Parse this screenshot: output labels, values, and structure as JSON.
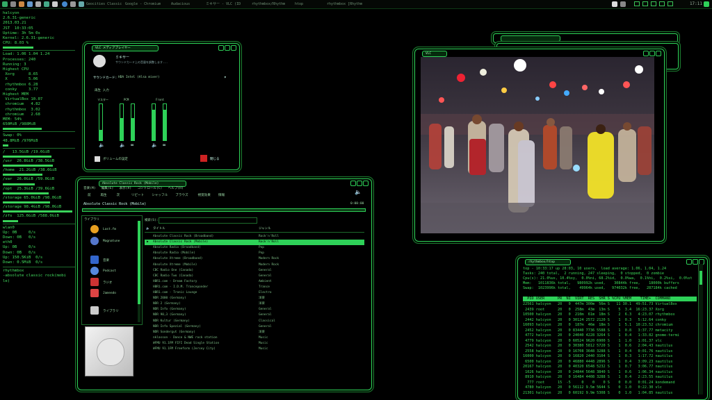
{
  "taskbar": {
    "tasks": [
      "Geocities Classic R",
      "Google - Chromium",
      "Audacious",
      "ミキサー - VLC (ID",
      "rhythmbox/Rhythm",
      "htop",
      "rhythmbox [Rhythm"
    ],
    "clock": "17:11"
  },
  "conky": {
    "lines": [
      "halcyon",
      "2.6.31-generic",
      "2013.03.21",
      "JST  10:33:05",
      "Uptime: 3h 5m 0s",
      "Kernel: 2.6.31-generic",
      "CPU: 8.03 %"
    ],
    "lines2": [
      "Load: 1.06 1.04 1.24",
      "Processes: 240",
      "Running: 3",
      "Highest CPU",
      " Xorg      8.65",
      " X         5.06",
      " rhythmbox 6.28",
      " conky     3.77",
      "Highest MEM",
      " VirtualBox 10.07",
      " chromium   4.82",
      " rhythmbox  3.02",
      " chromium   2.68",
      "MEM: 54%",
      "650MiB /988MiB"
    ],
    "lines3": [
      "Swap: 0%",
      "48.8MiB /976MiB"
    ],
    "disks": [
      "/   13.5GiB /19.6GiB",
      "/usr  26.8GiB /38.5GiB",
      "/home  21.2GiB /38.6GiB",
      "/var  26.0GiB /59.0GiB",
      "/opt  25.3GiB /39.6GiB",
      "/storage 65.0GiB /98.0GiB",
      "/storage 98.4GiB /98.0GiB",
      "/zfs  125.6GiB /588.0GiB"
    ],
    "net": [
      "wlan0",
      "Up: 0B     0/s",
      "Down: 0B   0/s",
      "eth0",
      "Up: 0B     0/s",
      "Down: 0B   0/s",
      "Up: 150.5KiB  0/s",
      "Down: 0.5MiB  0/s"
    ],
    "footer": [
      "rhythmbox",
      "-absolute classic rock(mobi",
      "le)"
    ]
  },
  "mixer": {
    "title": "VLC メディアプレイヤー",
    "heading": "ミキサー",
    "desc": "サウンドカード上の音量を調整します...",
    "card_label": "サウンドカード:",
    "card_value": "HDA Intel (Alsa mixer)",
    "tab": "再生  入力",
    "channels": [
      "マスター",
      "PCM",
      "Front"
    ],
    "levels": [
      0.28,
      0.62,
      0.85
    ],
    "footer_left": "ボリュームの設定",
    "close_label": "閉じる"
  },
  "rhythmbox": {
    "title": "Absolute Classic Rock (Mobile)",
    "menu": [
      "音楽(M)",
      "編集(E)",
      "表示(V)",
      "コントロール(C)",
      "ヘルプ(H)"
    ],
    "toolbar": [
      "前",
      "再生",
      "次",
      "リピート",
      "シャッフル",
      "ブラウズ",
      "視覚効果",
      "情報"
    ],
    "now_playing": "Absolute Classic Rock (Mobile)",
    "time": "0:00:00",
    "side_header": "ライブラリ",
    "side_items": [
      "Last.fm",
      "Magnatune",
      "音楽",
      "Podcast",
      "ラジオ",
      "Jamendo",
      "ライブラリ"
    ],
    "search_label": "検索(S):",
    "col_title": "タイトル",
    "col_genre": "ジャンル",
    "stations": [
      [
        "Absolute Classic Rock (Broadband)",
        "Rock'n'Roll"
      ],
      [
        "Absolute Classic Rock (Mobile)",
        "Rock'n'Roll"
      ],
      [
        "Absolute Radio (Broadband)",
        "Pop"
      ],
      [
        "Absolute Radio (Mobile)",
        "Pop"
      ],
      [
        "Absolute Xtreme (Broadband)",
        "Modern Rock"
      ],
      [
        "Absolute Xtreme (Mobile)",
        "Modern Rock"
      ],
      [
        "CBC Radio One (Canada)",
        "General"
      ],
      [
        "CBC Radio Two (Canada)",
        "General"
      ],
      [
        "HBR1.com - Dream Factory",
        "Ambient"
      ],
      [
        "HBR1.com - I.D.M. Tranceponder",
        "Trance"
      ],
      [
        "HBR1.com - Tronic Lounge",
        "Electro"
      ],
      [
        "NDR 2000 (Germany)",
        "洋楽"
      ],
      [
        "NDR 2 (Germany)",
        "洋楽"
      ],
      [
        "NDR Info (Germany)",
        "General"
      ],
      [
        "NDR 90,3 (Germany)",
        "General"
      ],
      [
        "NDR Kultur (Germany)",
        "Classical"
      ],
      [
        "NDR Info Spezial (Germany)",
        "General"
      ],
      [
        "NDR Sondergut (Germany)",
        "洋楽"
      ],
      [
        "nklasson - Dance & NWE rock station",
        "Music"
      ],
      [
        "WFMU 91.1FM FIFI Dead Single Station",
        "Music"
      ],
      [
        "WFMU 91.1FM Freeform (Jersey City)",
        "Music"
      ]
    ]
  },
  "video": {
    "title": "VLC"
  },
  "htop": {
    "title": "rhythmbox/htop",
    "summary": [
      "top - 10:33:17 up 28:03, 10 users,  load average: 1.06, 1.04, 1.24",
      "Tasks: 240 total,  2 running, 247 sleeping,  0 stopped,  0 zombie",
      "Cpu(s): 21.0%us, 10.4%sy,  0.0%ni, 68.2%id,  0.0%wa,  0.1%hi,  0.2%si,  0.0%st",
      "Mem:   1011836k total,   980992k used,    30844k free,    18000k buffers",
      "Swap:  1023996k total,    49964k used,   974032k free,   287184k cached"
    ],
    "header": "  PID USER      PR  NI  VIRT  RES  SHR S %CPU %MEM    TIME+  COMMAND",
    "rows": [
      "22561 halcyon   20   0  447m 300m  56m S   11 30.1  49:51.73 VirtualBox",
      " 2439 root      20   0  258m  43m  13m S    5  3.4  16:23.37 Xorg",
      "10500 halcyon   20   0  210m  61m  18m S    2  6.3   4:23.07 rhythmbox",
      " 2442 halcyon   20   0 30124 2572 2120 S    1  0.3   5:12.64 conky",
      "16093 halcyon   20   0  187m  46m  18m S    1  5.1  10:23.52 chromium",
      " 2452 halcyon   20   0 83440 7736 5588 S    1  0.8   3:37.77 metacity",
      " 4772 halcyon   20   0 24040 4228 3264 S    1  0.4   1:33.82 gnome-termi",
      " 4779 halcyon   20   0 60524 9620 6900 S    1  1.0   1:01.37 vlc",
      " 2542 halcyon   20   0 30380 5812 5720 S    1  0.6   2:04.43 nautilus",
      " 2558 halcyon   20   0 16708 3648 3288 S    1  0.4   0:01.76 nautilus",
      "16000 halcyon   20   0 16820 2440 3104 S    1  0.3   1:17.72 nautilus",
      " 6500 halcyon   20   0 46880 4448 2896 S    1  0.4   3:09.23 nautilus",
      "20167 halcyon   20   0 40320 6548 5232 S    1  0.7   3:06.77 nautilus",
      " 1026 halcyon   20   0 24844 5648 3840 S    1  0.6   1:06.34 nautilus",
      " 8910 halcyon   20   0 16484 4408 3288 S    1  0.4   2:23.55 nautilus",
      "  777 root      15  -5     0    0    0 S    0  0.0   0:01.24 kondemand",
      " 4780 halcyon   20   0 56112 9.5m 5644 S    0  1.0   0:22.30 vlc",
      "21301 halcyon   20   0 60192 9.9m 5308 S    0  1.0   1:04.85 nautilus"
    ]
  },
  "colors": {
    "accent": "#2ed158",
    "text": "#3ddc5a",
    "background": "#000000"
  }
}
